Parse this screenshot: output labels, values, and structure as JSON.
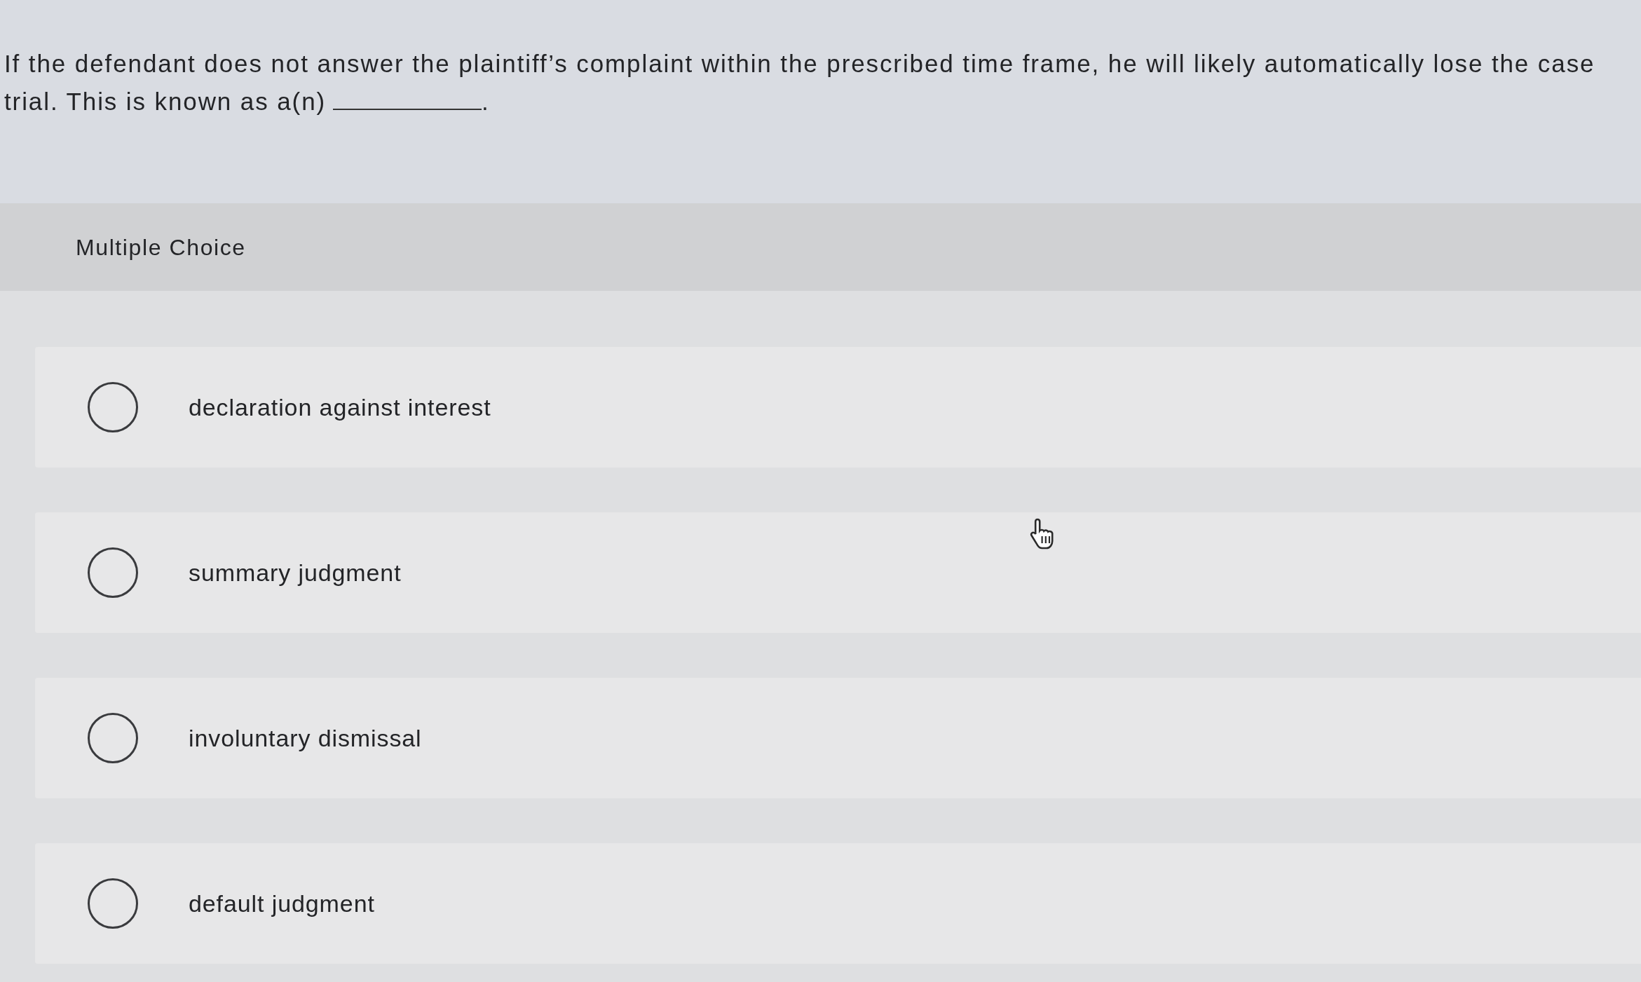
{
  "question": {
    "lines": [
      "If the defendant does not answer the plaintiff’s complaint within the prescribed time frame, he will likely automatically lose the case",
      "trial. This is known as a(n)"
    ],
    "after_blank": "."
  },
  "section": {
    "title": "Multiple Choice"
  },
  "options": [
    {
      "label": "declaration against interest",
      "selected": false
    },
    {
      "label": "summary judgment",
      "selected": false
    },
    {
      "label": "involuntary dismissal",
      "selected": false
    },
    {
      "label": "default judgment",
      "selected": false
    }
  ]
}
